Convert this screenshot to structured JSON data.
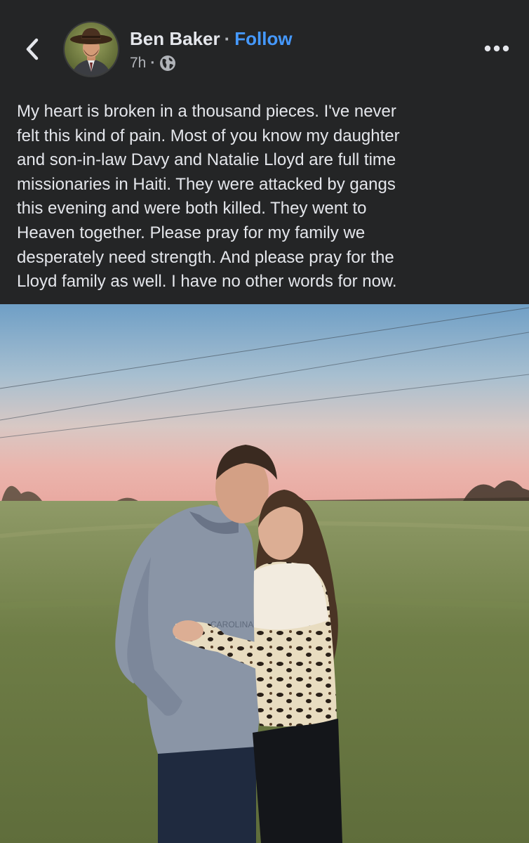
{
  "post": {
    "author": "Ben Baker",
    "separator": "·",
    "follow_label": "Follow",
    "time": "7h",
    "meta_separator": "·",
    "audience_icon": "globe-icon",
    "back_icon": "chevron-left-icon",
    "more_icon": "more-horizontal-icon",
    "text": "My heart is broken in a thousand pieces. I've never\nfelt this kind of pain. Most of you know my daughter\nand son-in-law Davy and Natalie Lloyd are full time\nmissionaries in Haiti. They were attacked by gangs\nthis evening and were both killed. They went to\nHeaven together. Please pray for my family we\ndesperately need strength. And please pray for the\nLloyd family as well. I have no other words for now.",
    "photo": {
      "hoodie_text": "CAROLINA"
    }
  },
  "colors": {
    "background": "#242526",
    "text": "#e4e6eb",
    "secondary_text": "#b0b3b8",
    "follow_link": "#4599ff"
  }
}
